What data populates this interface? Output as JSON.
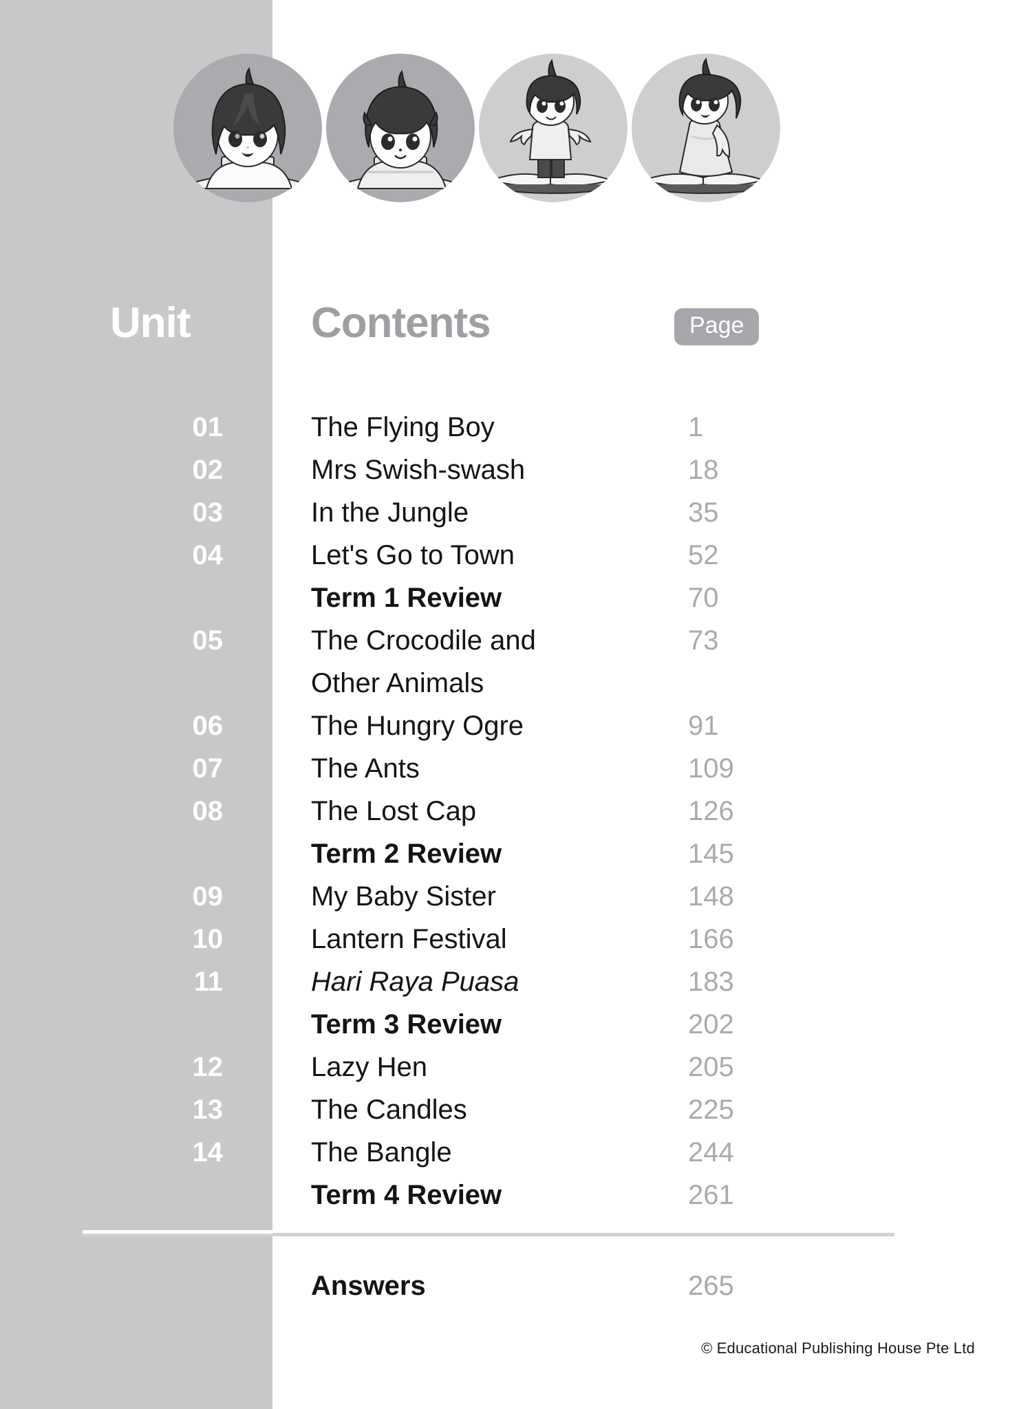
{
  "page": {
    "background": "#ffffff",
    "band_color": "#c8c8c9"
  },
  "header": {
    "unit_label": "Unit",
    "contents_label": "Contents",
    "page_label": "Page",
    "unit_color": "#ffffff",
    "contents_color": "#9d9fa2",
    "page_badge_color": "#a5a7aa"
  },
  "illustrations": [
    {
      "name": "girl-reading-at-desk",
      "circle_color": "#a9abae"
    },
    {
      "name": "boy-writing-at-desk",
      "circle_color": "#a9abae"
    },
    {
      "name": "boy-standing-on-book",
      "circle_color": "#cdcecf"
    },
    {
      "name": "girl-kneeling-on-book",
      "circle_color": "#cdcecf"
    }
  ],
  "toc": {
    "rows": [
      {
        "unit": "01",
        "title": "The Flying Boy",
        "page": "1",
        "style": "normal"
      },
      {
        "unit": "02",
        "title": "Mrs Swish-swash",
        "page": "18",
        "style": "normal"
      },
      {
        "unit": "03",
        "title": "In the Jungle",
        "page": "35",
        "style": "normal"
      },
      {
        "unit": "04",
        "title": "Let's Go to Town",
        "page": "52",
        "style": "normal"
      },
      {
        "unit": "",
        "title": "Term 1 Review",
        "page": "70",
        "style": "bold"
      },
      {
        "unit": "05",
        "title": "The Crocodile and",
        "title_line2": "Other Animals",
        "page": "73",
        "style": "normal"
      },
      {
        "unit": "06",
        "title": "The Hungry Ogre",
        "page": "91",
        "style": "normal"
      },
      {
        "unit": "07",
        "title": "The Ants",
        "page": "109",
        "style": "normal"
      },
      {
        "unit": "08",
        "title": "The Lost Cap",
        "page": "126",
        "style": "normal"
      },
      {
        "unit": "",
        "title": "Term 2 Review",
        "page": "145",
        "style": "bold"
      },
      {
        "unit": "09",
        "title": "My Baby Sister",
        "page": "148",
        "style": "normal"
      },
      {
        "unit": "10",
        "title": "Lantern Festival",
        "page": "166",
        "style": "normal"
      },
      {
        "unit": "11",
        "title": "Hari Raya Puasa",
        "page": "183",
        "style": "italic"
      },
      {
        "unit": "",
        "title": "Term 3 Review",
        "page": "202",
        "style": "bold"
      },
      {
        "unit": "12",
        "title": "Lazy Hen",
        "page": "205",
        "style": "normal"
      },
      {
        "unit": "13",
        "title": "The Candles",
        "page": "225",
        "style": "normal"
      },
      {
        "unit": "14",
        "title": "The Bangle",
        "page": "244",
        "style": "normal"
      },
      {
        "unit": "",
        "title": "Term 4 Review",
        "page": "261",
        "style": "bold"
      }
    ]
  },
  "answers": {
    "label": "Answers",
    "page": "265"
  },
  "footer": {
    "copyright": "© Educational Publishing House Pte Ltd"
  }
}
